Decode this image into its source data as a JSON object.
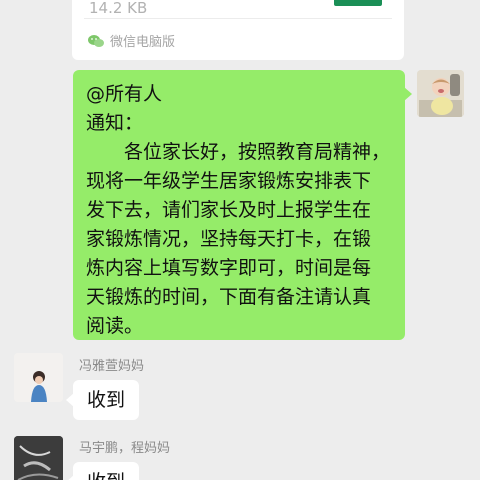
{
  "file_card": {
    "size": "14.2 KB",
    "source": "微信电脑版",
    "source_icon": "wechat-icon"
  },
  "outgoing_message": {
    "lines": [
      "@所有人",
      "通知：",
      "　　各位家长好，按照教育局精神，",
      "现将一年级学生居家锻炼安排表下",
      "发下去，请们家长及时上报学生在",
      "家锻炼情况，坚持每天打卡，在锻",
      "炼内容上填写数字即可，时间是每",
      "天锻炼的时间，下面有备注请认真",
      "阅读。"
    ]
  },
  "replies": [
    {
      "sender": "冯雅萱妈妈",
      "text": "收到"
    },
    {
      "sender": "马宇鹏，程妈妈",
      "text": "收到"
    }
  ],
  "colors": {
    "background": "#ededed",
    "outgoing_bubble": "#95ec69",
    "incoming_bubble": "#ffffff",
    "file_accent": "#1a8f56"
  }
}
